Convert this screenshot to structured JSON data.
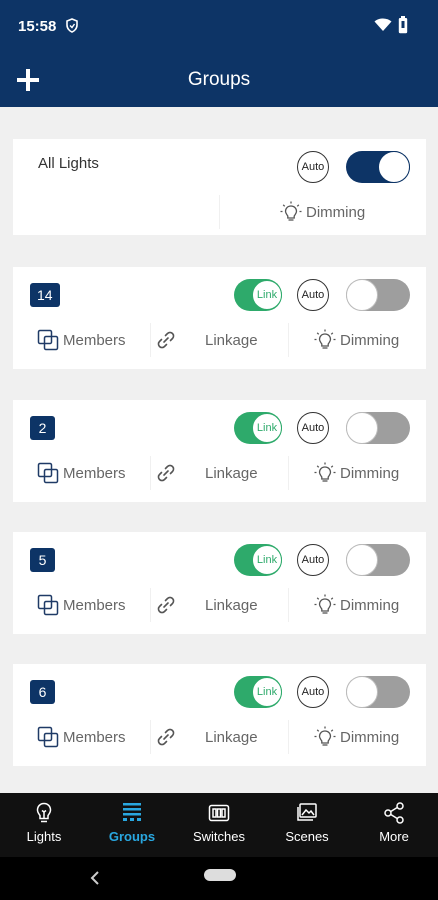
{
  "status_bar": {
    "time": "15:58"
  },
  "app_bar": {
    "title": "Groups"
  },
  "all_lights": {
    "label": "All Lights",
    "auto_label": "Auto",
    "dimming_label": "Dimming",
    "power_on": true
  },
  "groups": [
    {
      "number": "14",
      "link_label": "Link",
      "auto_label": "Auto",
      "members_label": "Members",
      "linkage_label": "Linkage",
      "dimming_label": "Dimming",
      "power_on": false
    },
    {
      "number": "2",
      "link_label": "Link",
      "auto_label": "Auto",
      "members_label": "Members",
      "linkage_label": "Linkage",
      "dimming_label": "Dimming",
      "power_on": false
    },
    {
      "number": "5",
      "link_label": "Link",
      "auto_label": "Auto",
      "members_label": "Members",
      "linkage_label": "Linkage",
      "dimming_label": "Dimming",
      "power_on": false
    },
    {
      "number": "6",
      "link_label": "Link",
      "auto_label": "Auto",
      "members_label": "Members",
      "linkage_label": "Linkage",
      "dimming_label": "Dimming",
      "power_on": false
    }
  ],
  "bottom_nav": [
    {
      "label": "Lights",
      "icon": "bulb-icon"
    },
    {
      "label": "Groups",
      "icon": "groups-icon",
      "active": true
    },
    {
      "label": "Switches",
      "icon": "switch-icon"
    },
    {
      "label": "Scenes",
      "icon": "scene-icon"
    },
    {
      "label": "More",
      "icon": "share-icon"
    }
  ],
  "colors": {
    "primary": "#0d3466",
    "link_green": "#2eaa6b",
    "nav_active": "#29a7e0",
    "background": "#f0f0f0"
  }
}
